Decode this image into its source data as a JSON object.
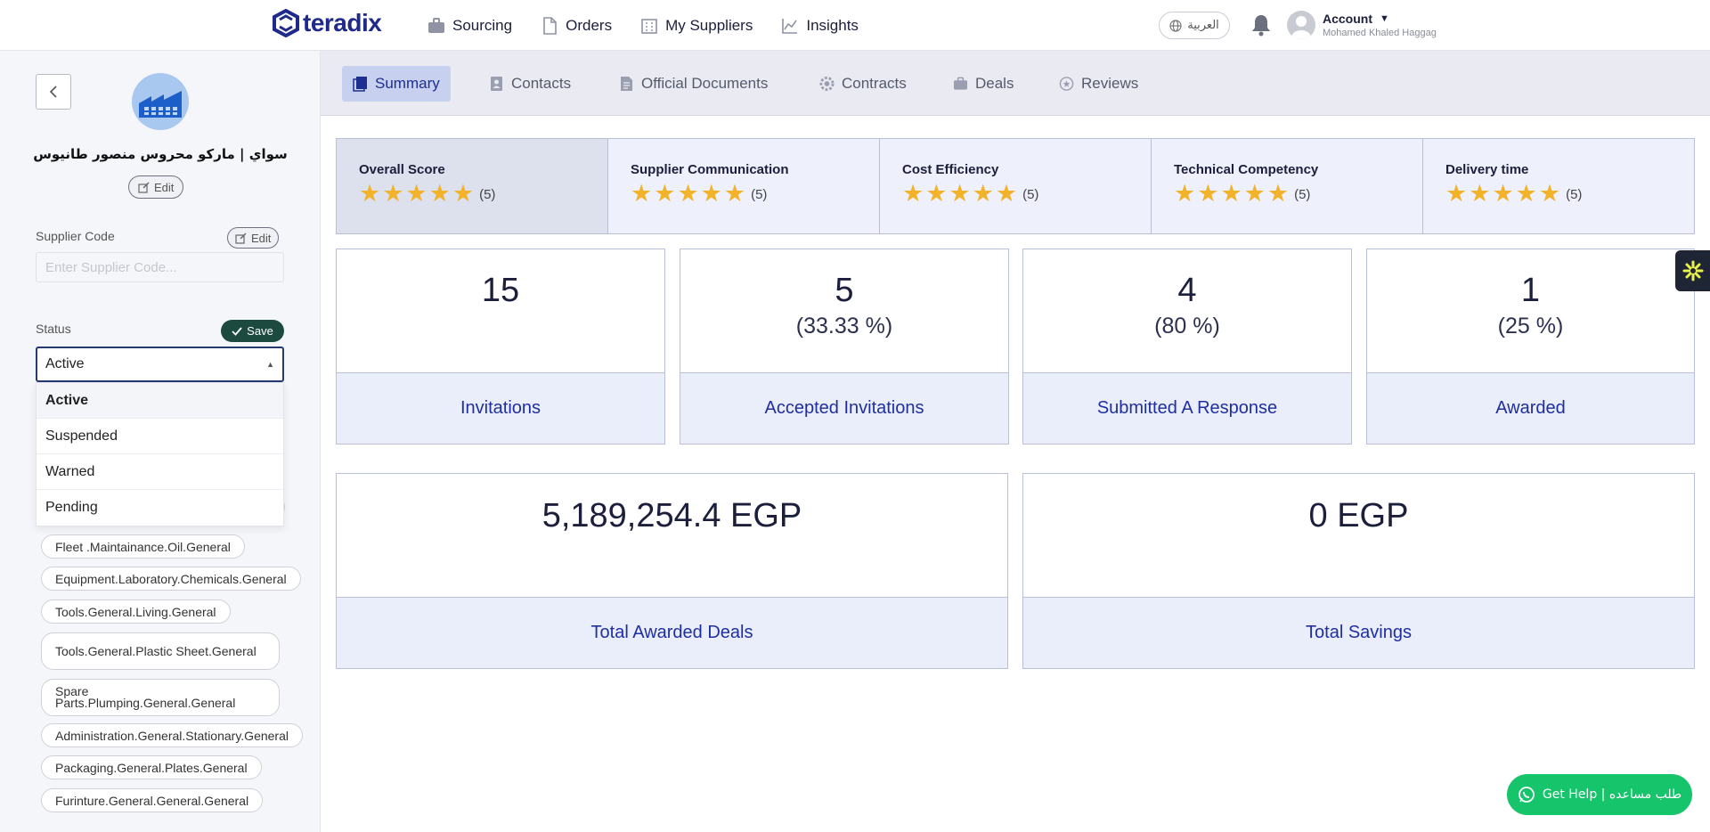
{
  "brand": {
    "name": "teradix",
    "color": "#1f2a8a"
  },
  "nav": {
    "items": [
      {
        "label": "Sourcing",
        "icon": "briefcase-icon"
      },
      {
        "label": "Orders",
        "icon": "document-icon"
      },
      {
        "label": "My Suppliers",
        "icon": "building-icon"
      },
      {
        "label": "Insights",
        "icon": "chart-line-icon"
      }
    ],
    "language": "العربية",
    "account_label": "Account",
    "account_name": "Mohamed Khaled Haggag"
  },
  "sidebar": {
    "company_name": "سواي | ماركو محروس منصور طانيوس",
    "edit_label": "Edit",
    "supplier_code_label": "Supplier Code",
    "supplier_code_placeholder": "Enter Supplier Code...",
    "status_label": "Status",
    "save_label": "Save",
    "status_value": "Active",
    "status_options": [
      "Active",
      "Suspended",
      "Warned",
      "Pending"
    ],
    "categories": [
      "Fleet .Maintainance.Oil.General",
      "Equipment.Laboratory.Chemicals.General",
      "Tools.General.Living.General",
      "Tools.General.Plastic Sheet.General",
      "Spare Parts.Plumping.General.General",
      "Administration.General.Stationary.General",
      "Packaging.General.Plates.General",
      "Furinture.General.General.General"
    ]
  },
  "tabs": [
    {
      "label": "Summary",
      "icon": "summary-icon",
      "active": true
    },
    {
      "label": "Contacts",
      "icon": "contact-icon",
      "active": false
    },
    {
      "label": "Official Documents",
      "icon": "file-icon",
      "active": false
    },
    {
      "label": "Contracts",
      "icon": "gear-icon",
      "active": false
    },
    {
      "label": "Deals",
      "icon": "briefcase-icon",
      "active": false
    },
    {
      "label": "Reviews",
      "icon": "review-icon",
      "active": false
    }
  ],
  "scores": [
    {
      "title": "Overall Score",
      "rating": 5,
      "label": "(5)"
    },
    {
      "title": "Supplier Communication",
      "rating": 5,
      "label": "(5)"
    },
    {
      "title": "Cost Efficiency",
      "rating": 5,
      "label": "(5)"
    },
    {
      "title": "Technical Competency",
      "rating": 5,
      "label": "(5)"
    },
    {
      "title": "Delivery time",
      "rating": 5,
      "label": "(5)"
    }
  ],
  "metrics": [
    {
      "value": "15",
      "percent": "",
      "label": "Invitations"
    },
    {
      "value": "5",
      "percent": "(33.33 %)",
      "label": "Accepted Invitations"
    },
    {
      "value": "4",
      "percent": "(80 %)",
      "label": "Submitted A Response"
    },
    {
      "value": "1",
      "percent": "(25 %)",
      "label": "Awarded"
    }
  ],
  "totals": [
    {
      "value": "5,189,254.4 EGP",
      "label": "Total Awarded Deals"
    },
    {
      "value": "0 EGP",
      "label": "Total Savings"
    }
  ],
  "help_button": "Get Help | طلب مساعده",
  "colors": {
    "star": "#f2b32a",
    "accent": "#1f2fa0",
    "help": "#16c46b",
    "save": "#1d4a3e"
  }
}
